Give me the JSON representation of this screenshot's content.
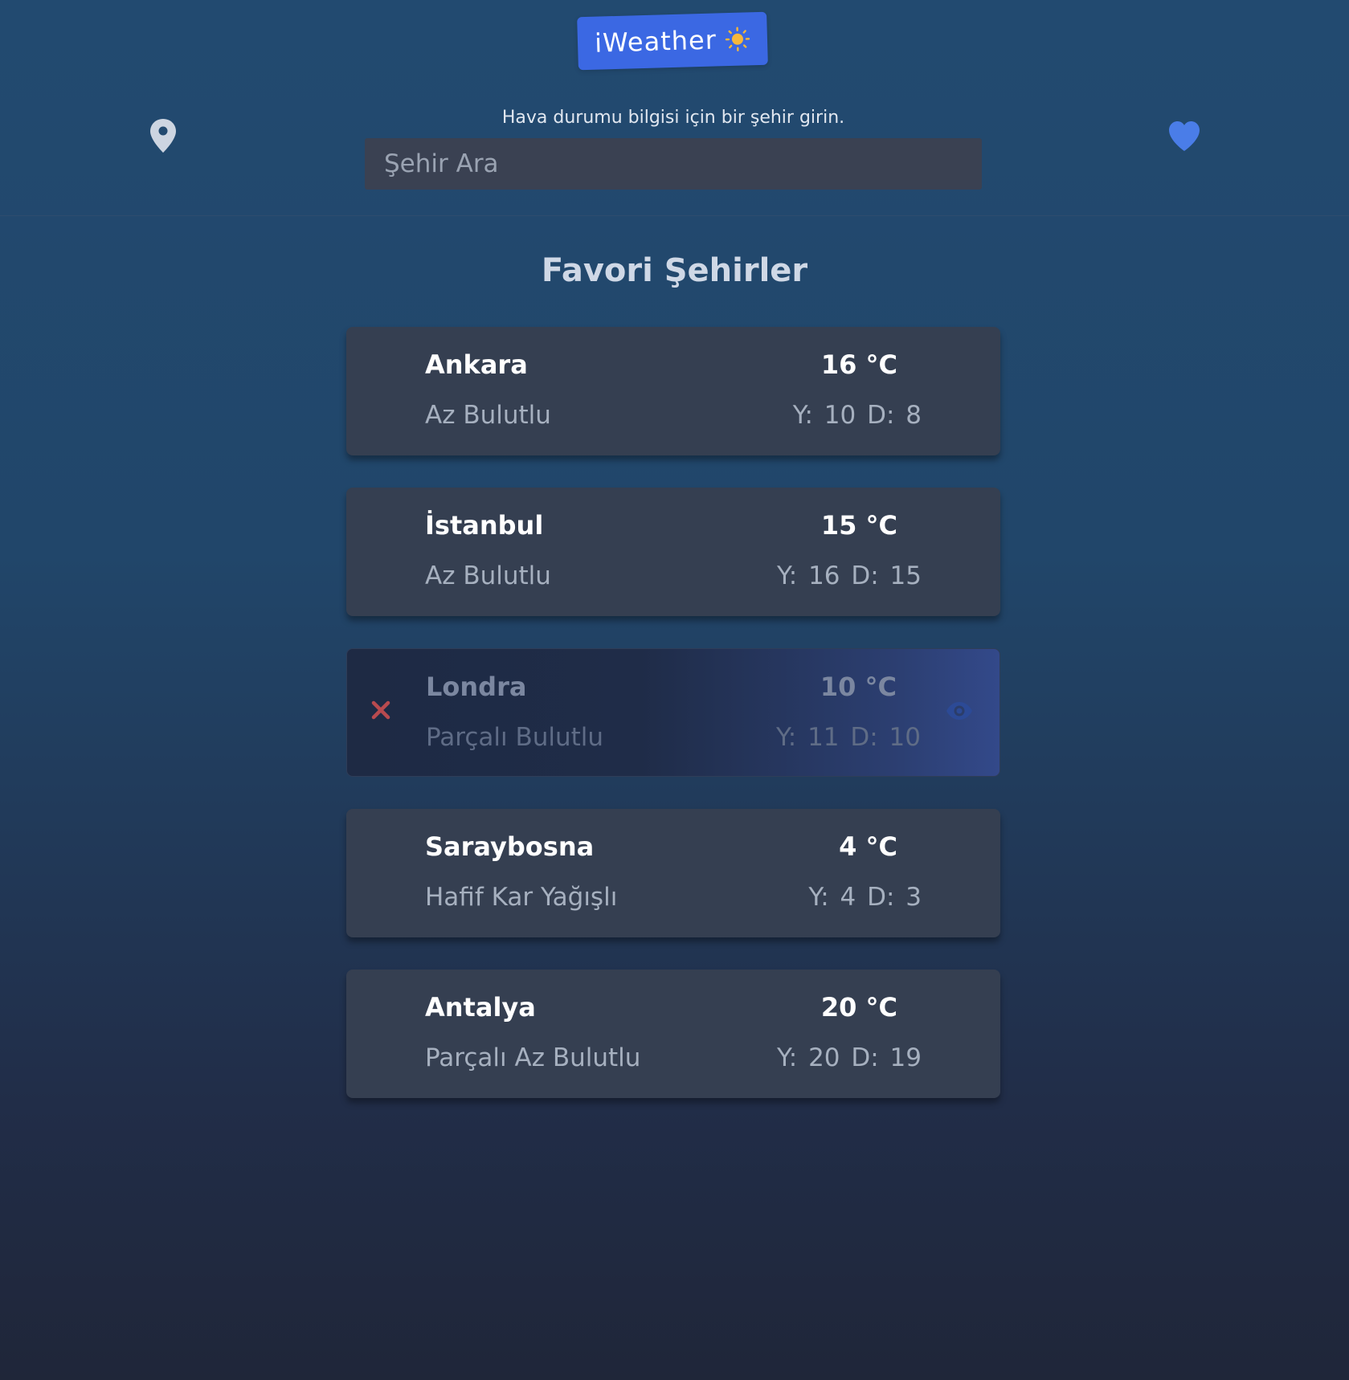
{
  "header": {
    "logo_text": "iWeather",
    "search_hint": "Hava durumu bilgisi için bir şehir girin.",
    "search_placeholder": "Şehir Ara",
    "location_icon": "map-pin-icon",
    "favorites_icon": "heart-icon"
  },
  "favorites": {
    "title": "Favori Şehirler",
    "cities": [
      {
        "name": "Ankara",
        "temp": "16 °C",
        "desc": "Az Bulutlu",
        "range": "Y: 10  D: 8"
      },
      {
        "name": "İstanbul",
        "temp": "15 °C",
        "desc": "Az Bulutlu",
        "range": "Y: 16  D: 15"
      },
      {
        "name": "Londra",
        "temp": "10 °C",
        "desc": "Parçalı Bulutlu",
        "range": "Y: 11  D: 10"
      },
      {
        "name": "Saraybosna",
        "temp": "4 °C",
        "desc": "Hafif Kar Yağışlı",
        "range": "Y: 4  D: 3"
      },
      {
        "name": "Antalya",
        "temp": "20 °C",
        "desc": "Parçalı Az Bulutlu",
        "range": "Y: 20  D: 19"
      }
    ]
  },
  "colors": {
    "accent": "#3b68e3",
    "card": "#353f51",
    "remove": "#b84a4f",
    "heart": "#4a7de8"
  }
}
